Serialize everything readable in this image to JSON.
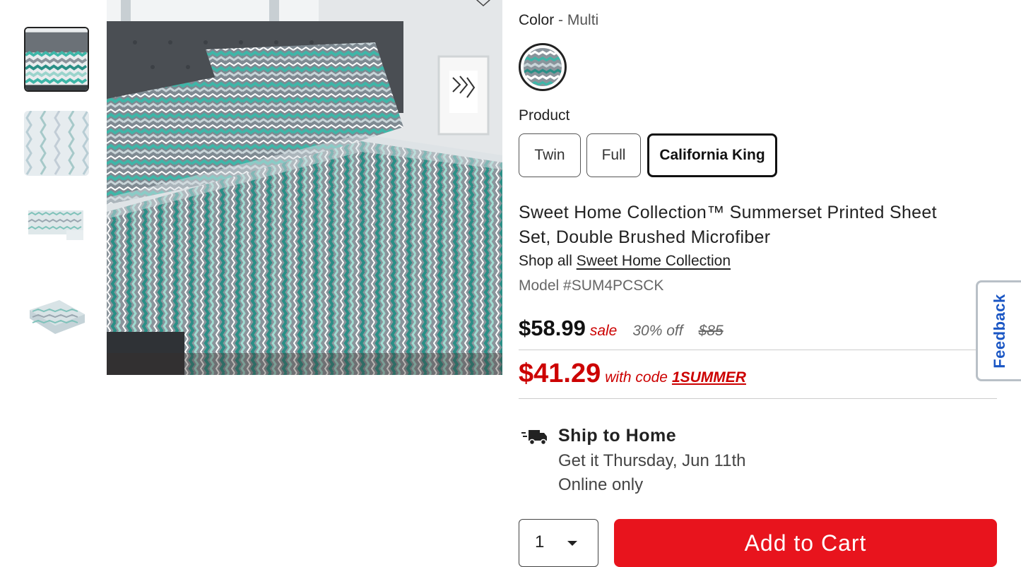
{
  "gallery": {
    "thumbnails": [
      {
        "label": "sheet-set-on-bed",
        "selected": true
      },
      {
        "label": "fabric-closeup",
        "selected": false
      },
      {
        "label": "flat-sheet-and-cases",
        "selected": false
      },
      {
        "label": "folded-set",
        "selected": false
      }
    ]
  },
  "color": {
    "label": "Color",
    "separator": " - ",
    "value": "Multi"
  },
  "product_selector": {
    "label": "Product",
    "options": [
      "Twin",
      "Full",
      "California King"
    ],
    "selected": "California King"
  },
  "product": {
    "title": "Sweet Home Collection™ Summerset Printed Sheet Set, Double Brushed Microfiber",
    "shop_all_prefix": "Shop all",
    "brand_link": "Sweet Home Collection",
    "model": "Model #SUM4PCSCK"
  },
  "pricing": {
    "sale_price": "$58.99",
    "sale_label": "sale",
    "discount": "30% off",
    "original_price": "$85",
    "promo_price": "$41.29",
    "promo_text": "with code",
    "promo_code": "1SUMMER"
  },
  "shipping": {
    "title": "Ship to Home",
    "date": "Get it Thursday, Jun 11th",
    "availability": "Online only"
  },
  "cart": {
    "quantity": "1",
    "button_label": "Add to Cart"
  },
  "feedback": {
    "label": "Feedback"
  },
  "colors": {
    "accent_red": "#e8141d",
    "sale_red": "#cc0000",
    "feedback_blue": "#1a56c4",
    "teal": "#3fb6a8"
  }
}
